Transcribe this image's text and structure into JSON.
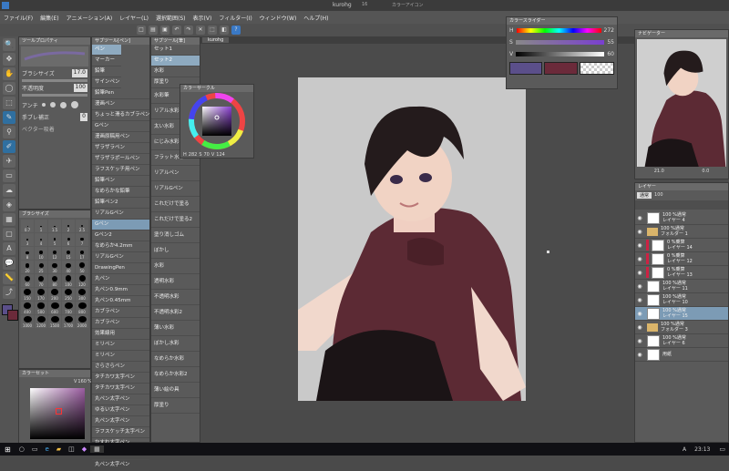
{
  "app": {
    "title": "kurohg",
    "title_num": "16",
    "subtitle": "カラーアイコン"
  },
  "menu": [
    "ファイル(F)",
    "編集(E)",
    "アニメーション(A)",
    "レイヤー(L)",
    "選択範囲(S)",
    "表示(V)",
    "フィルター(I)",
    "ウィンドウ(W)",
    "ヘルプ(H)"
  ],
  "tool_property": {
    "header": "ツールプロパティ",
    "brush_size_label": "ブラシサイズ",
    "brush_size_value": "17.0",
    "opacity_label": "不透明度",
    "opacity_value": "100",
    "aa_label": "アンチ",
    "correction_label": "手ブレ補正",
    "correction_value": "0",
    "vector_label": "ベクター吸着"
  },
  "brush_size_panel": {
    "header": "ブラシサイズ",
    "sizes": [
      "0.7",
      "1",
      "1.5",
      "2",
      "2.5",
      "3",
      "4",
      "5",
      "6",
      "7",
      "8",
      "10",
      "12",
      "15",
      "17",
      "20",
      "25",
      "30",
      "40",
      "50",
      "60",
      "70",
      "80",
      "100",
      "120",
      "150",
      "170",
      "200",
      "250",
      "300",
      "400",
      "500",
      "600",
      "700",
      "800",
      "1000",
      "1200",
      "1500",
      "1700",
      "2000"
    ]
  },
  "subtool_panel": {
    "header": "サブツール[ペン]",
    "tabs": [
      "ペン",
      "マーカー",
      "鉛筆",
      "サインペン"
    ],
    "items": [
      "鉛筆Pen",
      "漫画ペン",
      "ちょっと滑るカブラペン",
      "Gペン",
      "漫画原稿用ペン",
      "ザラザラペン",
      "ザラザラポールペン",
      "ラフスケッチ用ペン",
      "鉛筆ペン",
      "なめらかな鉛筆",
      "鉛筆ペン2",
      "リアルGペン",
      "Gペン",
      "Gペン2",
      "なめらか4.2mm",
      "リアルGペン",
      "DrawingPen",
      "丸ペン",
      "丸ペン0.9mm",
      "丸ペン0.45mm",
      "カブラペン",
      "カブラペン",
      "効果線用",
      "ミリペン",
      "ミリペン",
      "さらさらペン",
      "タチカワ太字ペン",
      "タチカワ太字ペン",
      "丸ペン太字ペン",
      "ゆるい太字ペン",
      "丸ペン太字ペン",
      "ラフスケッチ太字ペン",
      "かすれ太字ペン",
      "かすれ太字ペン",
      "丸ペン太字ペン"
    ]
  },
  "subtool_panel2": {
    "header": "サブツール[筆]",
    "tabs": [
      "セット1",
      "セット2",
      "水彩",
      "厚塗り"
    ],
    "items": [
      "水彩筆",
      "リアル水彩",
      "太い水彩",
      "にじみ水彩",
      "フラット水彩",
      "リアルペン",
      "リアルGペン",
      "これだけで塗る",
      "これだけで塗る2",
      "塗り消しゴム",
      "ぼかし",
      "水彩",
      "透明水彩",
      "不透明水彩",
      "不透明水彩2",
      "薄い水彩",
      "ぼかし水彩",
      "なめらか水彩",
      "なめらか水彩2",
      "薄い絵の具",
      "厚塗り"
    ]
  },
  "color_circle": {
    "header": "カラーサークル",
    "h": "282",
    "s": "70",
    "v": "124"
  },
  "color_slider": {
    "header": "カラースライダー",
    "h": "272",
    "s": "55",
    "v": "60"
  },
  "color_set": {
    "header": "カラーセット",
    "v_label": "V",
    "v_value": "160",
    "percent": "%"
  },
  "navigator": {
    "header": "ナビゲーター",
    "zoom": "21.0",
    "rotate": "0.0"
  },
  "layer_panel": {
    "header": "レイヤー",
    "blend": "通常",
    "opacity": "100",
    "layers": [
      {
        "pct": "100 %通常",
        "name": "レイヤー 4",
        "type": "layer",
        "mark": false,
        "selected": false
      },
      {
        "pct": "100 %通常",
        "name": "フォルダー 1",
        "type": "folder",
        "mark": false,
        "selected": false
      },
      {
        "pct": "0 %乗算",
        "name": "レイヤー 14",
        "type": "layer",
        "mark": true,
        "selected": false
      },
      {
        "pct": "0 %乗算",
        "name": "レイヤー 12",
        "type": "layer",
        "mark": true,
        "selected": false
      },
      {
        "pct": "0 %乗算",
        "name": "レイヤー 13",
        "type": "layer",
        "mark": true,
        "selected": false
      },
      {
        "pct": "100 %通常",
        "name": "レイヤー 11",
        "type": "layer",
        "mark": false,
        "selected": false
      },
      {
        "pct": "100 %通常",
        "name": "レイヤー 10",
        "type": "layer",
        "mark": false,
        "selected": false
      },
      {
        "pct": "100 %通常",
        "name": "レイヤー 15",
        "type": "layer",
        "mark": false,
        "selected": true
      },
      {
        "pct": "100 %通常",
        "name": "フォルダー 3",
        "type": "folder",
        "mark": false,
        "selected": false
      },
      {
        "pct": "100 %通常",
        "name": "レイヤー 6",
        "type": "layer",
        "mark": false,
        "selected": false
      },
      {
        "pct": "",
        "name": "用紙",
        "type": "paper",
        "mark": false,
        "selected": false
      }
    ]
  },
  "canvas_tab": "kurohg",
  "taskbar": {
    "time": "23:13",
    "lang": "A"
  },
  "colors": {
    "main": "#5b4f8a",
    "sub": "#6b2a3a",
    "accent": "#2f6fa0"
  }
}
